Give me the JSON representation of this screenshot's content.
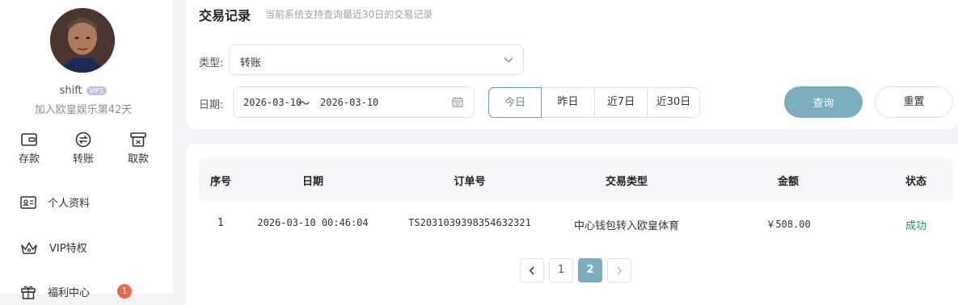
{
  "user": {
    "name": "shift",
    "vip_badge": "VIP1",
    "join_text": "加入欧皇娱乐第42天"
  },
  "quick_actions": [
    {
      "label": "存款",
      "icon": "wallet-icon"
    },
    {
      "label": "转账",
      "icon": "transfer-icon"
    },
    {
      "label": "取款",
      "icon": "withdraw-icon"
    }
  ],
  "menu": [
    {
      "label": "个人资料",
      "icon": "id-card-icon"
    },
    {
      "label": "VIP特权",
      "icon": "crown-icon"
    },
    {
      "label": "福利中心",
      "icon": "gift-icon",
      "badge": "1"
    }
  ],
  "header": {
    "title": "交易记录",
    "subtitle": "当前系统支持查询最近30日的交易记录"
  },
  "filters": {
    "type_label": "类型:",
    "type_value": "转账",
    "date_label": "日期:",
    "date_start": "2026-03-10",
    "date_sep": "～",
    "date_end": "2026-03-10",
    "quick_dates": [
      "今日",
      "昨日",
      "近7日",
      "近30日"
    ],
    "active_quick_date": "今日",
    "query_label": "查询",
    "reset_label": "重置"
  },
  "table": {
    "headers": [
      "序号",
      "日期",
      "订单号",
      "交易类型",
      "金额",
      "状态"
    ],
    "rows": [
      {
        "index": "1",
        "date": "2026-03-10 00:46:04",
        "order_no": "TS2031039398354632321",
        "type": "中心钱包转入欧皇体育",
        "amount": "￥508.00",
        "status": "成功"
      }
    ]
  },
  "pagination": {
    "pages": [
      "1",
      "2"
    ],
    "current": "2"
  },
  "colors": {
    "accent": "#7aaebd",
    "success": "#1a9a5c",
    "badge": "#f0664a"
  }
}
